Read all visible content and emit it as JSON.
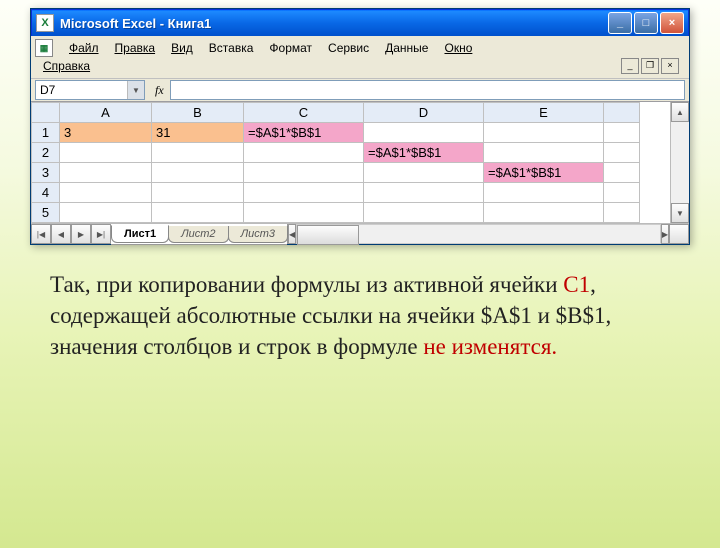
{
  "window": {
    "title": "Microsoft Excel - Книга1"
  },
  "menu": {
    "file": "Файл",
    "edit": "Правка",
    "view": "Вид",
    "insert": "Вставка",
    "format": "Формат",
    "service": "Сервис",
    "data": "Данные",
    "window": "Окно",
    "help": "Справка"
  },
  "namebox": "D7",
  "fx": "fx",
  "cols": {
    "A": "A",
    "B": "B",
    "C": "C",
    "D": "D",
    "E": "E"
  },
  "rows": {
    "r1": "1",
    "r2": "2",
    "r3": "3",
    "r4": "4",
    "r5": "5"
  },
  "cells": {
    "A1": "3",
    "B1": "31",
    "C1": "=$A$1*$B$1",
    "D2": "=$A$1*$B$1",
    "E3": "=$A$1*$B$1"
  },
  "tabs": {
    "t1": "Лист1",
    "t2": "Лист2",
    "t3": "Лист3"
  },
  "explanation": {
    "p1a": "Так, при копировании формулы из активной ячейки ",
    "p1c": "С1",
    "p1b": ", содержащей абсолютные ссылки на ячейки $A$1 и $B$1, значения столбцов и строк в формуле ",
    "p1d": "не изменятся."
  }
}
